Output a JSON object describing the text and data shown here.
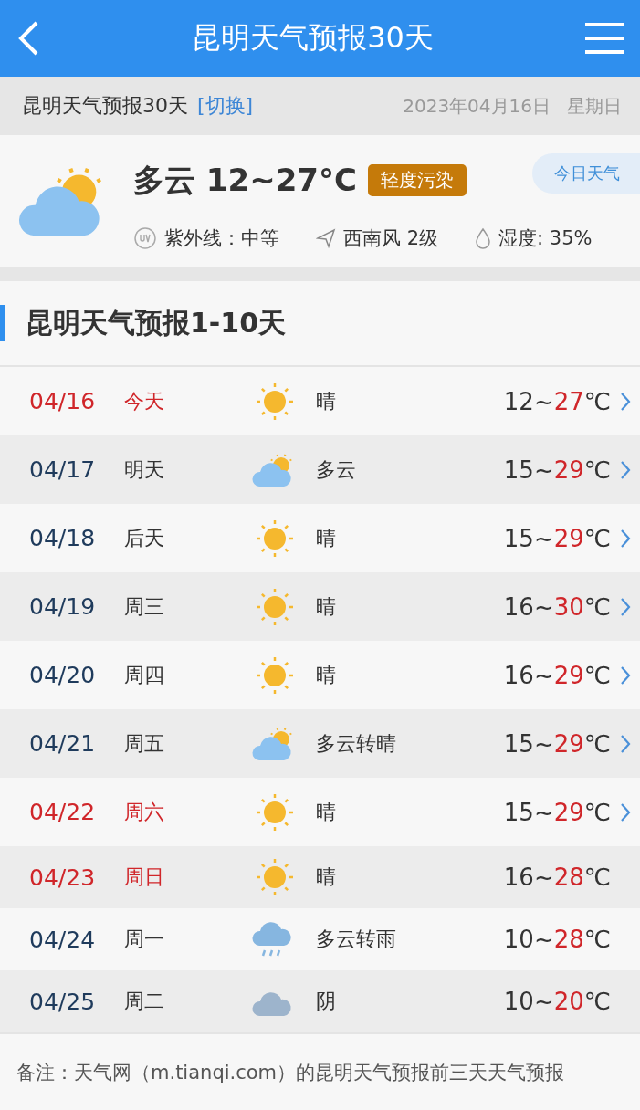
{
  "header": {
    "title": "昆明天气预报30天"
  },
  "subheader": {
    "title": "昆明天气预报30天",
    "switch_link": "[切换]",
    "date": "2023年04月16日",
    "weekday": "星期日"
  },
  "current": {
    "kind": "partly-cloudy",
    "condition": "多云 12~27°C",
    "air_quality": "轻度污染",
    "today_button": "今日天气",
    "uv": "紫外线：中等",
    "wind": "西南风 2级",
    "humidity": "湿度: 35%"
  },
  "section_title": "昆明天气预报1-10天",
  "days": [
    {
      "date": "04/16",
      "day": "今天",
      "highlight": true,
      "kind": "sun",
      "weather": "晴",
      "low": "12~",
      "high": "27",
      "unit": "℃",
      "link": true
    },
    {
      "date": "04/17",
      "day": "明天",
      "highlight": false,
      "kind": "partly-cloudy",
      "weather": "多云",
      "low": "15~",
      "high": "29",
      "unit": "℃",
      "link": true
    },
    {
      "date": "04/18",
      "day": "后天",
      "highlight": false,
      "kind": "sun",
      "weather": "晴",
      "low": "15~",
      "high": "29",
      "unit": "℃",
      "link": true
    },
    {
      "date": "04/19",
      "day": "周三",
      "highlight": false,
      "kind": "sun",
      "weather": "晴",
      "low": "16~",
      "high": "30",
      "unit": "℃",
      "link": true
    },
    {
      "date": "04/20",
      "day": "周四",
      "highlight": false,
      "kind": "sun",
      "weather": "晴",
      "low": "16~",
      "high": "29",
      "unit": "℃",
      "link": true
    },
    {
      "date": "04/21",
      "day": "周五",
      "highlight": false,
      "kind": "partly-cloudy",
      "weather": "多云转晴",
      "low": "15~",
      "high": "29",
      "unit": "℃",
      "link": true
    },
    {
      "date": "04/22",
      "day": "周六",
      "highlight": true,
      "kind": "sun",
      "weather": "晴",
      "low": "15~",
      "high": "29",
      "unit": "℃",
      "link": true
    },
    {
      "date": "04/23",
      "day": "周日",
      "highlight": true,
      "kind": "sun",
      "weather": "晴",
      "low": "16~",
      "high": "28",
      "unit": "℃",
      "link": false
    },
    {
      "date": "04/24",
      "day": "周一",
      "highlight": false,
      "kind": "rain",
      "weather": "多云转雨",
      "low": "10~",
      "high": "28",
      "unit": "℃",
      "link": false
    },
    {
      "date": "04/25",
      "day": "周二",
      "highlight": false,
      "kind": "overcast",
      "weather": "阴",
      "low": "10~",
      "high": "20",
      "unit": "℃",
      "link": false
    }
  ],
  "note": "备注：天气网（m.tianqi.com）的昆明天气预报前三天天气预报"
}
